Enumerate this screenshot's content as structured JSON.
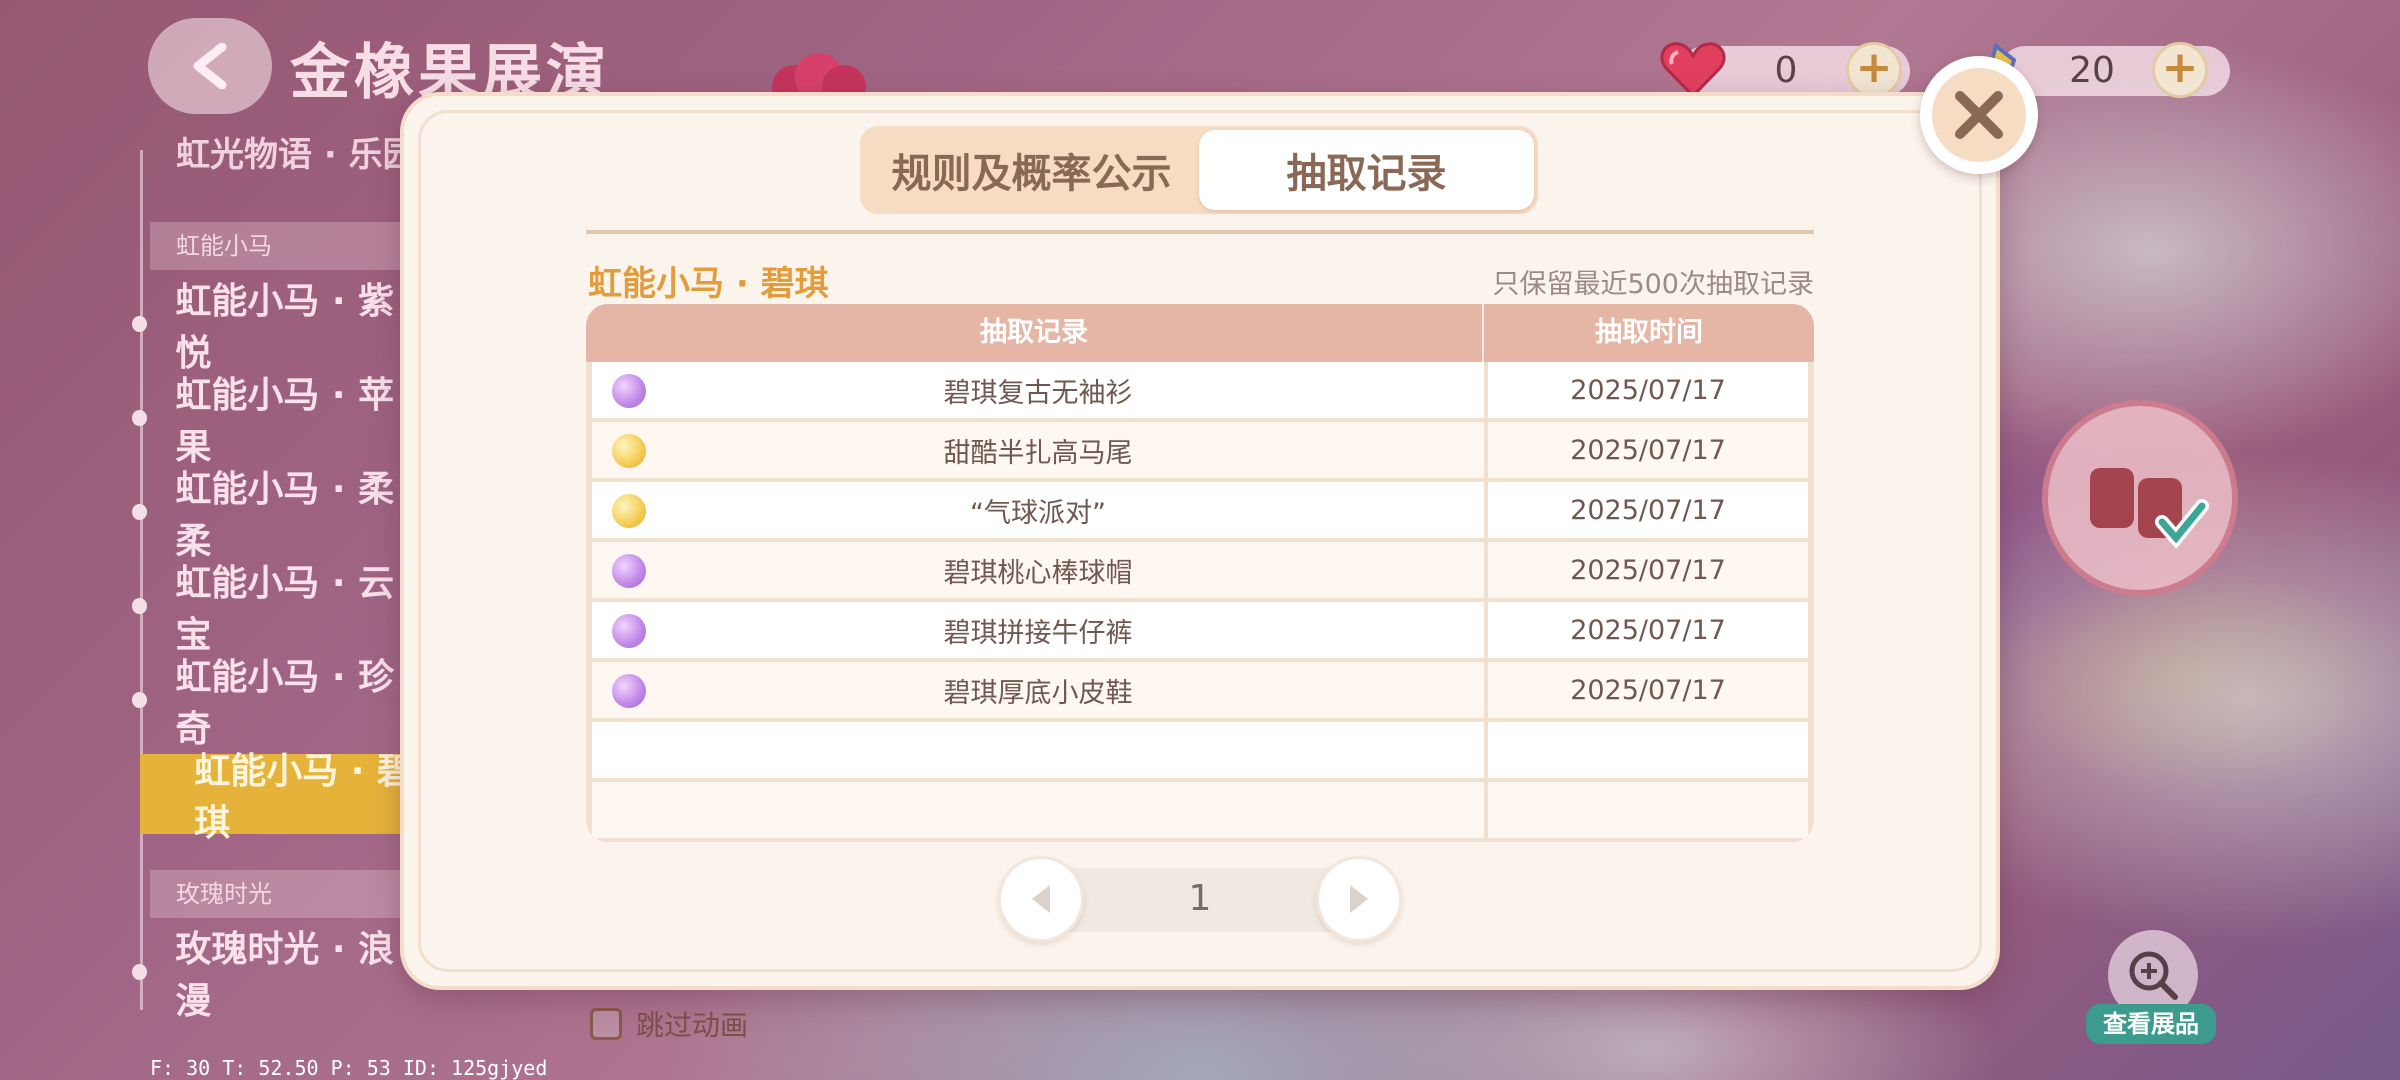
{
  "header": {
    "title": "金橡果展演",
    "hearts_value": "0",
    "tickets_value": "20"
  },
  "left_menu": {
    "partial_top": "虹光物语 · 乐园",
    "sections": [
      {
        "label": "虹能小马"
      },
      {
        "label": "玫瑰时光"
      }
    ],
    "items": [
      {
        "label": "虹能小马 · 紫悦"
      },
      {
        "label": "虹能小马 · 苹果"
      },
      {
        "label": "虹能小马 · 柔柔"
      },
      {
        "label": "虹能小马 · 云宝"
      },
      {
        "label": "虹能小马 · 珍奇"
      },
      {
        "label": "虹能小马 · 碧琪"
      },
      {
        "label": "玫瑰时光 · 浪漫"
      }
    ],
    "skip_animation": "跳过动画"
  },
  "debug": "F: 30    T: 52.50    P: 53    ID: 125gjyed",
  "view_exhibit": "查看展品",
  "modal": {
    "tabs": [
      {
        "label": "规则及概率公示",
        "active": false
      },
      {
        "label": "抽取记录",
        "active": true
      }
    ],
    "record_title": "虹能小马 · 碧琪",
    "record_note": "只保留最近500次抽取记录",
    "columns": {
      "item": "抽取记录",
      "time": "抽取时间"
    },
    "rows": [
      {
        "item": "碧琪复古无袖衫",
        "time": "2025/07/17",
        "rarity": "purple"
      },
      {
        "item": "甜酷半扎高马尾",
        "time": "2025/07/17",
        "rarity": "gold"
      },
      {
        "item": "“气球派对”",
        "time": "2025/07/17",
        "rarity": "gold"
      },
      {
        "item": "碧琪桃心棒球帽",
        "time": "2025/07/17",
        "rarity": "purple"
      },
      {
        "item": "碧琪拼接牛仔裤",
        "time": "2025/07/17",
        "rarity": "purple"
      },
      {
        "item": "碧琪厚底小皮鞋",
        "time": "2025/07/17",
        "rarity": "purple"
      },
      {
        "item": "",
        "time": "",
        "rarity": ""
      },
      {
        "item": "",
        "time": "",
        "rarity": ""
      }
    ],
    "page": "1"
  }
}
